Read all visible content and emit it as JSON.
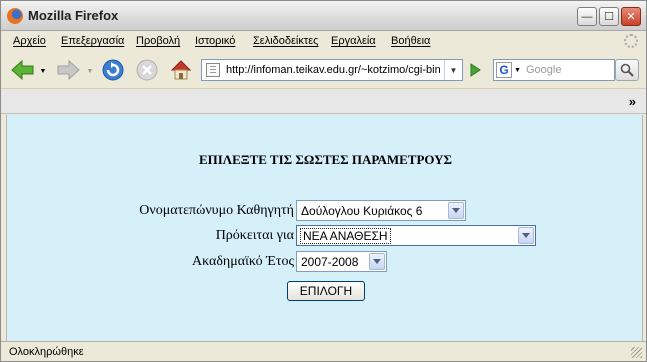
{
  "window": {
    "title": "Mozilla Firefox",
    "controls": {
      "minimize": "—",
      "maximize": "☐",
      "close": "✕"
    }
  },
  "menu": [
    "Αρχείο",
    "Επεξεργασία",
    "Προβολή",
    "Ιστορικό",
    "Σελιδοδείκτες",
    "Εργαλεία",
    "Βοήθεια"
  ],
  "navigation": {
    "url": "http://infoman.teikav.edu.gr/~kotzimo/cgi-bin/",
    "search_placeholder": "Google",
    "search_engine_letter": "G",
    "icons": [
      "back-icon",
      "forward-icon",
      "reload-icon",
      "stop-icon",
      "home-icon",
      "go-icon",
      "search-icon"
    ]
  },
  "bookmarks": {
    "overflow": "»"
  },
  "form": {
    "heading": "ΕΠΙΛΕΞΤΕ ΤΙΣ ΣΩΣΤΕΣ ΠΑΡΑΜΕΤΡΟΥΣ",
    "professor_label": "Ονοματεπώνυμο Καθηγητή",
    "professor_value": "Δούλογλου Κυριάκος 6",
    "subject_label": "Πρόκειται για",
    "subject_value": "ΝΕΑ ΑΝΑΘΕΣΗ",
    "year_label": "Ακαδημαϊκό Έτος",
    "year_value": "2007-2008",
    "submit_label": "ΕΠΙΛΟΓΗ"
  },
  "status": {
    "text": "Ολοκληρώθηκε"
  },
  "colors": {
    "content_bg": "#d6f0fa",
    "chrome_bg": "#ece9d8",
    "close_red": "#c8412a"
  }
}
